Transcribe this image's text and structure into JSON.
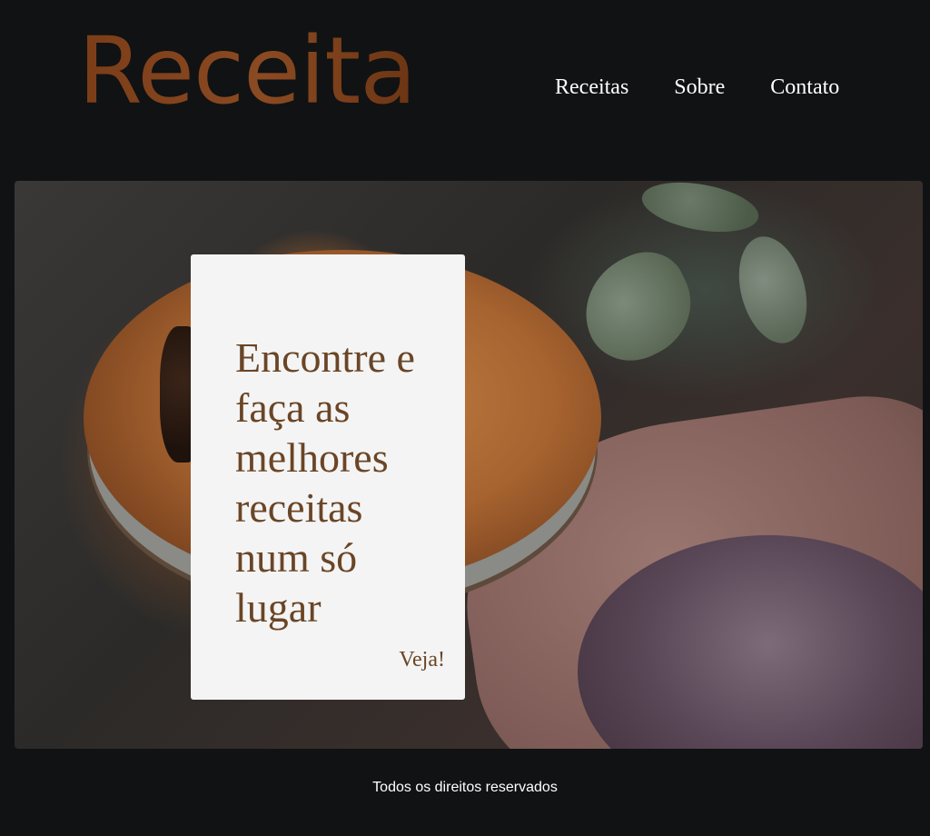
{
  "header": {
    "logo": "Receita",
    "nav": {
      "item1": "Receitas",
      "item2": "Sobre",
      "item3": "Contato"
    }
  },
  "hero": {
    "card": {
      "title": "Encontre e faça as melhores receitas num só lugar",
      "cta": "Veja!"
    }
  },
  "footer": {
    "text": "Todos os direitos reservados"
  },
  "colors": {
    "background": "#111213",
    "brand": "#7b3d18",
    "card_text": "#6a4526",
    "card_bg": "#f4f4f4"
  }
}
